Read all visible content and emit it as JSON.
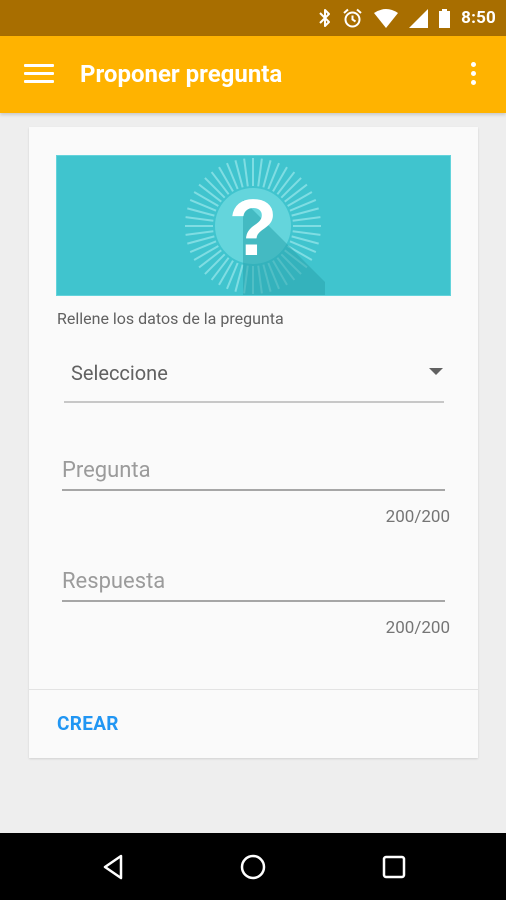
{
  "status_bar": {
    "time": "8:50",
    "icons": [
      "bluetooth-icon",
      "alarm-icon",
      "wifi-icon",
      "cell-signal-icon",
      "battery-icon"
    ]
  },
  "app_bar": {
    "title": "Proponer pregunta",
    "background": "#ffb300",
    "status_color": "#a86e00"
  },
  "form": {
    "banner_icon": "question-mark",
    "banner_glyph": "?",
    "banner_color": "#40c4ce",
    "hint": "Rellene los datos de la pregunta",
    "category": {
      "value": "Seleccione"
    },
    "question": {
      "placeholder": "Pregunta",
      "value": "",
      "counter": "200/200"
    },
    "answer": {
      "placeholder": "Respuesta",
      "value": "",
      "counter": "200/200"
    },
    "submit_label": "CREAR",
    "accent": "#2196f3"
  },
  "nav_bar": {
    "buttons": [
      "back-icon",
      "home-icon",
      "recents-icon"
    ]
  }
}
